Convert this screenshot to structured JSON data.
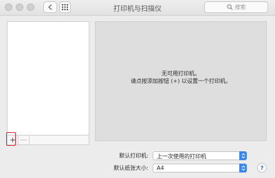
{
  "window": {
    "title": "打印机与扫描仪"
  },
  "toolbar": {
    "search_placeholder": "搜索",
    "icons": {
      "back": "chevron-left-icon",
      "forward": "chevron-right-icon",
      "grid": "grid-icon",
      "search": "search-icon"
    }
  },
  "list": {
    "add_label": "+",
    "remove_label": "—",
    "highlight_color": "#e0262b"
  },
  "detail": {
    "line1": "无可用打印机。",
    "line2": "请点按添加按钮 (+) 以设置一个打印机。"
  },
  "settings": {
    "default_printer_label": "默认打印机:",
    "default_printer_value": "上一次使用的打印机",
    "paper_size_label": "默认纸张大小:",
    "paper_size_value": "A4"
  },
  "help": {
    "label": "?"
  },
  "colors": {
    "accent": "#3b86f0"
  }
}
